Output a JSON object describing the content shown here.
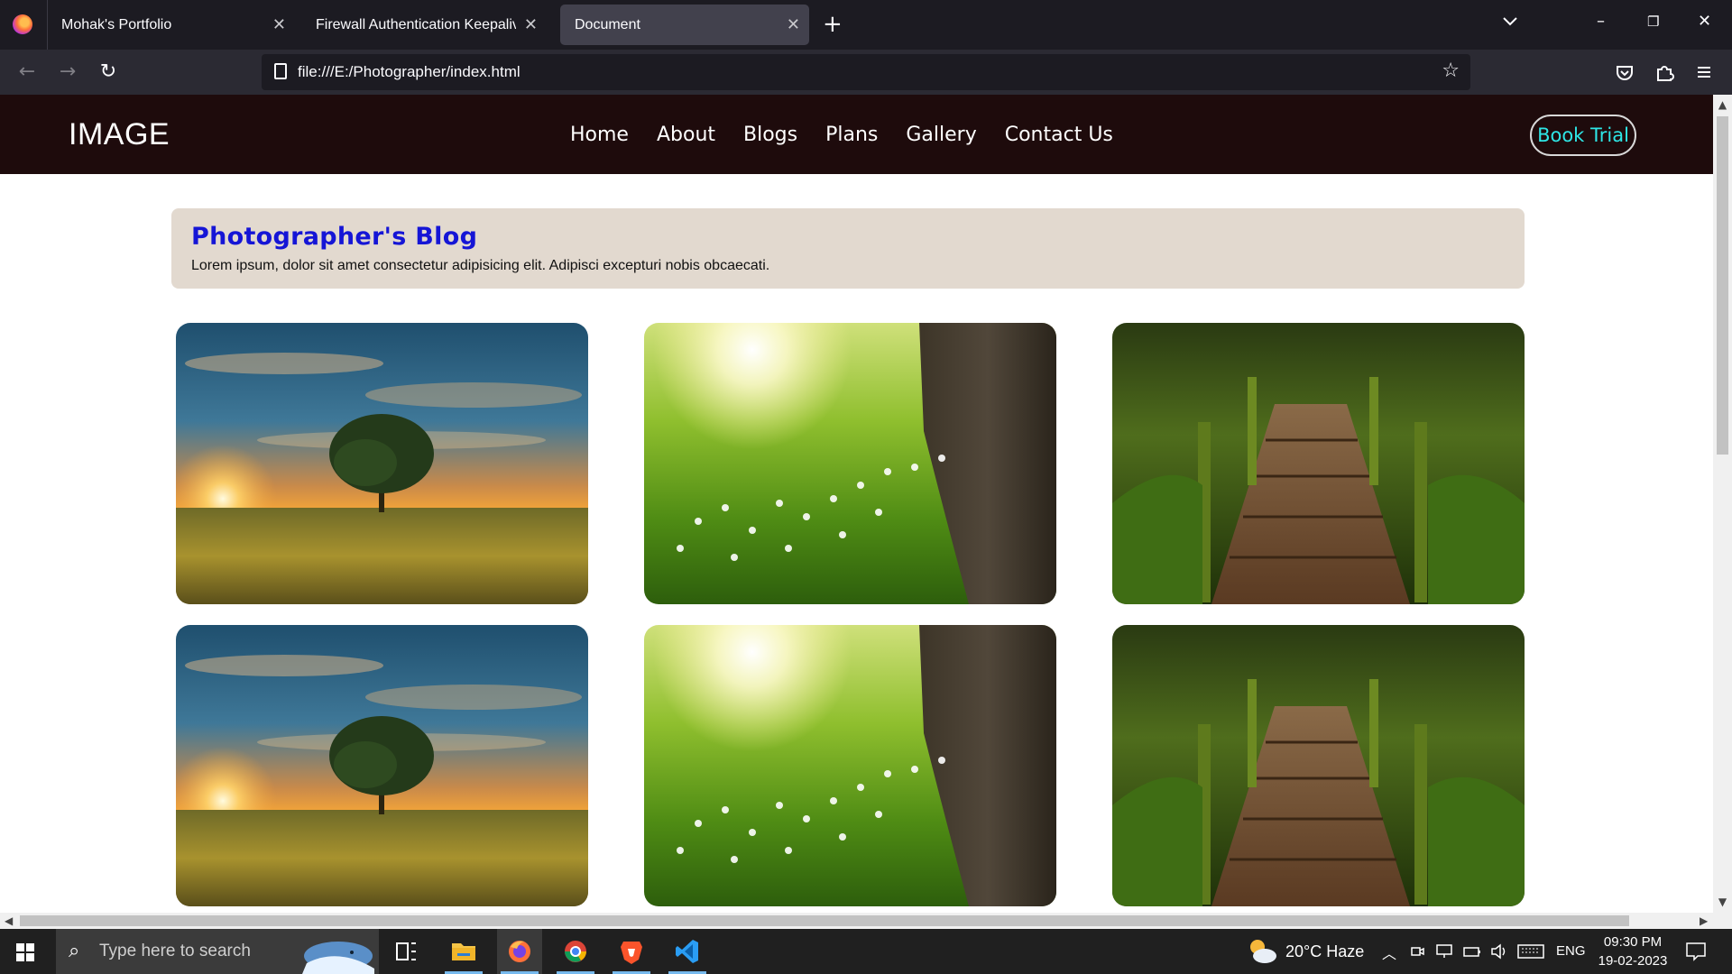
{
  "browser": {
    "tabs": [
      {
        "title": "Mohak's Portfolio",
        "active": false
      },
      {
        "title": "Firewall Authentication Keepalive W",
        "active": false
      },
      {
        "title": "Document",
        "active": true
      }
    ],
    "new_tab_label": "+",
    "url": "file:///E:/Photographer/index.html"
  },
  "site": {
    "logo": "IMAGE",
    "nav": [
      "Home",
      "About",
      "Blogs",
      "Plans",
      "Gallery",
      "Contact Us"
    ],
    "cta": "Book Trial",
    "accent_color": "#2ee6e6",
    "header_color": "#1e0b0c"
  },
  "blog": {
    "title": "Photographer's Blog",
    "description": "Lorem ipsum, dolor sit amet consectetur adipisicing elit. Adipisci excepturi nobis obcaecati.",
    "title_color": "#1515d6",
    "box_color": "#e2d9cf"
  },
  "gallery": {
    "photos": [
      {
        "subject": "sunset-tree-field"
      },
      {
        "subject": "sunlit-meadow-tree-trunk"
      },
      {
        "subject": "mossy-forest-boardwalk"
      },
      {
        "subject": "sunset-tree-field"
      },
      {
        "subject": "sunlit-meadow-tree-trunk"
      },
      {
        "subject": "mossy-forest-boardwalk"
      }
    ]
  },
  "taskbar": {
    "search_placeholder": "Type here to search",
    "weather": "20°C  Haze",
    "language": "ENG",
    "time": "09:30 PM",
    "date": "19-02-2023",
    "apps": [
      "task-view",
      "file-explorer",
      "firefox",
      "chrome",
      "brave",
      "vscode"
    ]
  }
}
